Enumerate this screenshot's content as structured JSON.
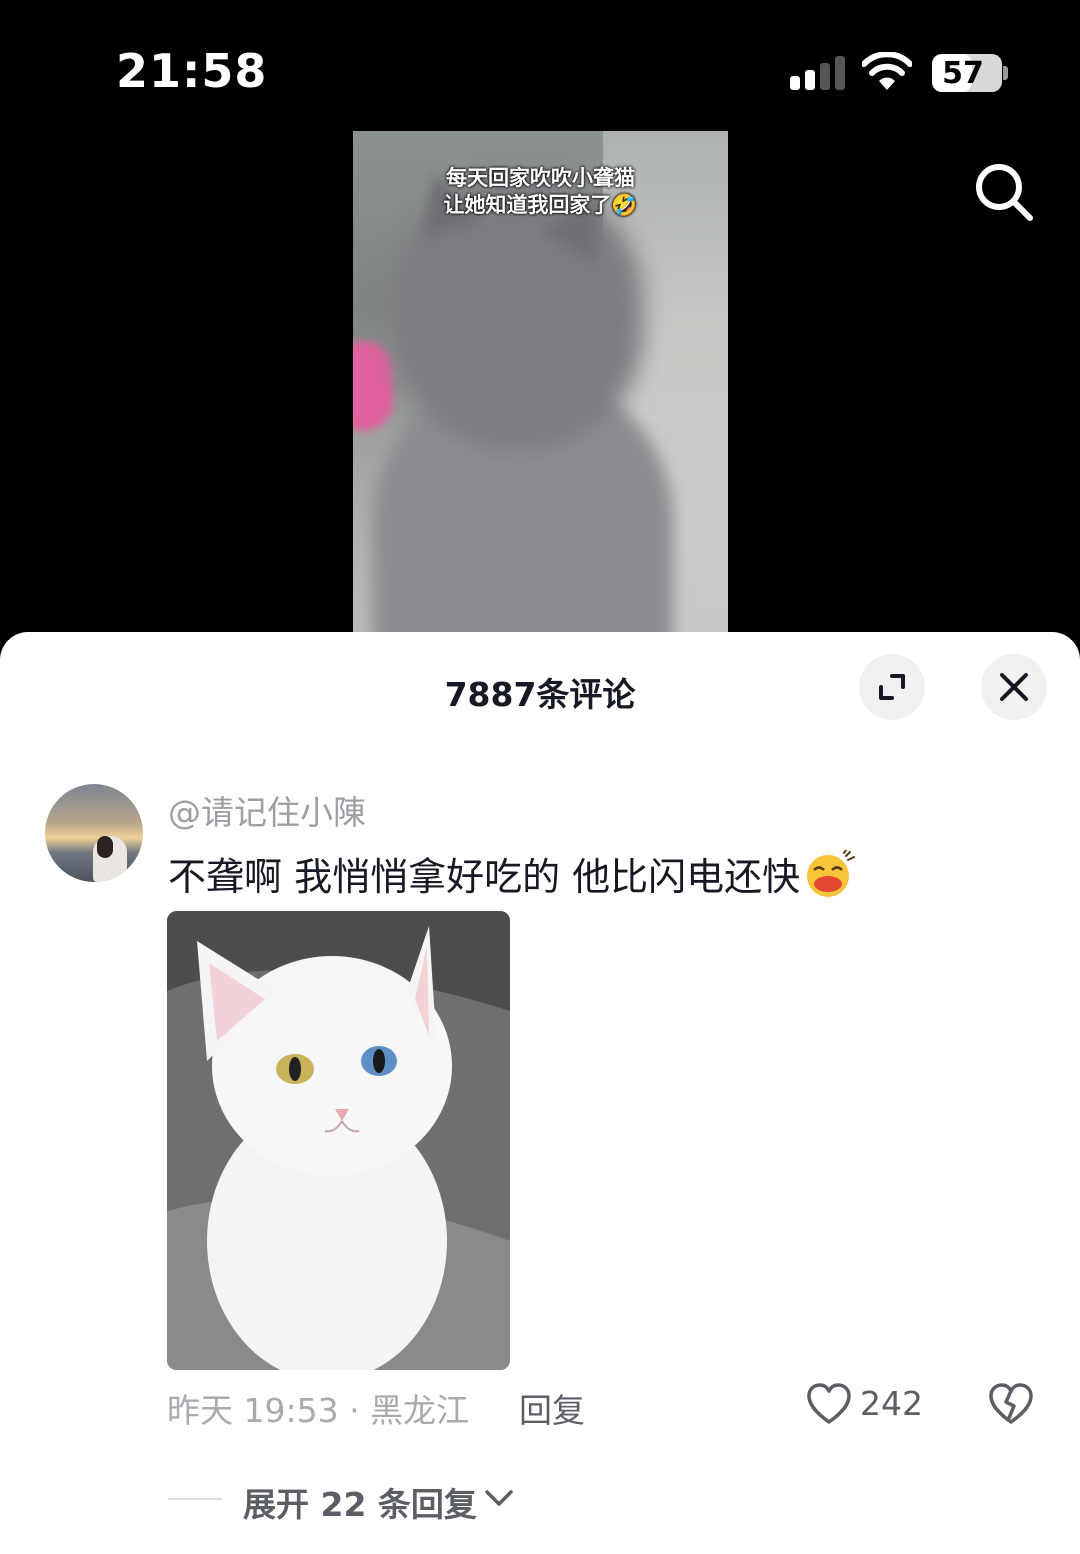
{
  "status_bar": {
    "time": "21:58",
    "battery": "57",
    "battery_level_percent": 57,
    "signal_bars_active": 2,
    "icons": [
      "signal-icon",
      "wifi-icon",
      "battery-icon"
    ]
  },
  "video": {
    "caption_line1": "每天回家吹吹小聋猫",
    "caption_line2": "让她知道我回家了🤣",
    "search_icon": "search-icon"
  },
  "comments_sheet": {
    "title": "7887条评论",
    "expand_icon": "expand-icon",
    "close_icon": "close-icon",
    "comment": {
      "username": "@请记住小陳",
      "text": "不聋啊  我悄悄拿好吃的  他比闪电还快",
      "time_location": "昨天 19:53 · 黑龙江",
      "reply_label": "回复",
      "like_count": "242",
      "expand_replies": "展开 22 条回复"
    }
  },
  "colors": {
    "primary_text": "#161823",
    "secondary_text": "#9d9fa4",
    "background_dark": "#000000",
    "sheet_background": "#ffffff"
  }
}
